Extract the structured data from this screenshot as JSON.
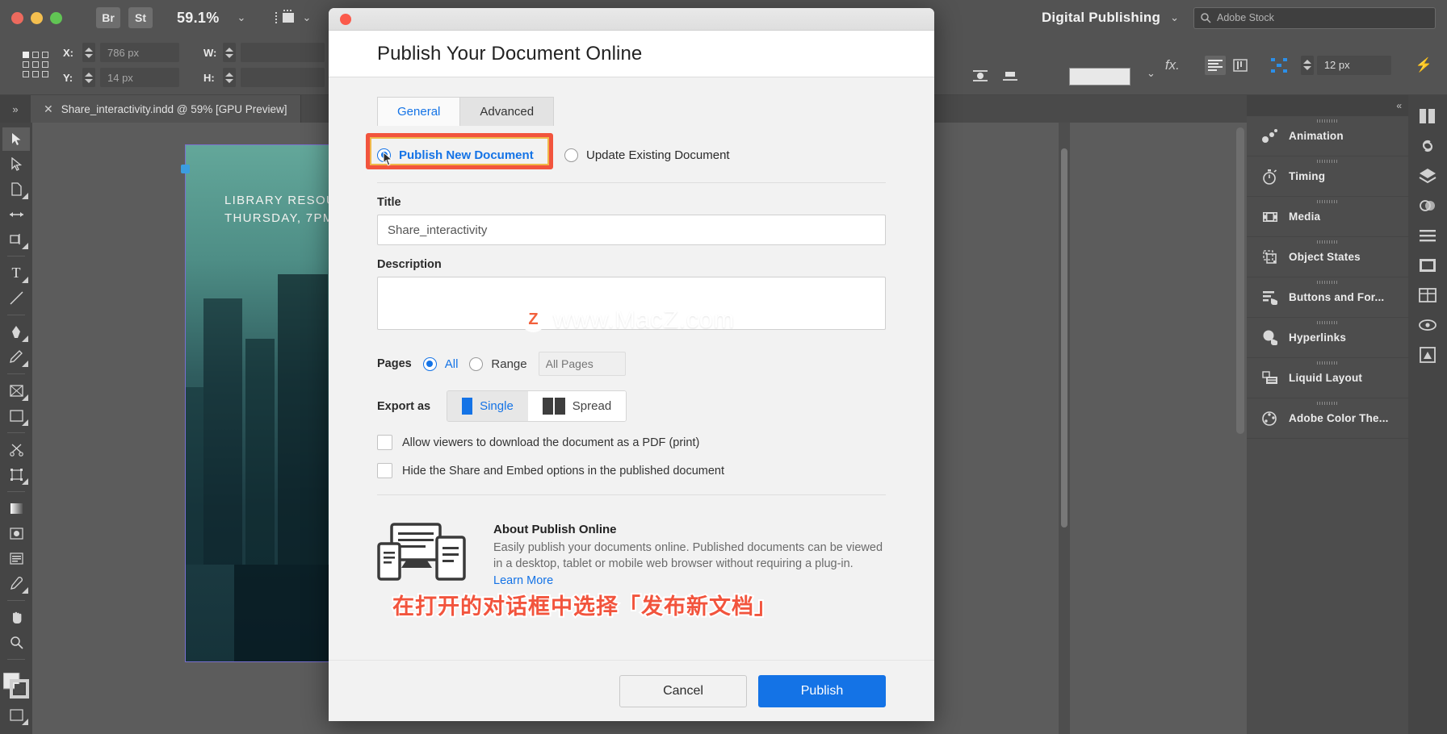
{
  "app": {
    "zoom_level": "59.1%",
    "bridge_button": "Br",
    "stock_button": "St",
    "workspace": "Digital Publishing",
    "stock_search_placeholder": "Adobe Stock",
    "document_tab": "Share_interactivity.indd @ 59% [GPU Preview]"
  },
  "options_bar": {
    "x_label": "X:",
    "x_value": "786 px",
    "y_label": "Y:",
    "y_value": "14 px",
    "w_label": "W:",
    "w_value": "",
    "h_label": "H:",
    "h_value": "",
    "fx_label": "fx.",
    "leading_value": "12 px"
  },
  "page_content": {
    "line1": "LIBRARY RESOU",
    "line2": "THURSDAY, 7PM"
  },
  "panels": {
    "items": [
      {
        "label": "Animation",
        "icon": "animation-icon"
      },
      {
        "label": "Timing",
        "icon": "timing-icon"
      },
      {
        "label": "Media",
        "icon": "media-icon"
      },
      {
        "label": "Object States",
        "icon": "object-states-icon"
      },
      {
        "label": "Buttons and For...",
        "icon": "buttons-forms-icon"
      },
      {
        "label": "Hyperlinks",
        "icon": "hyperlinks-icon"
      },
      {
        "label": "Liquid Layout",
        "icon": "liquid-layout-icon"
      },
      {
        "label": "Adobe Color The...",
        "icon": "adobe-color-icon"
      }
    ],
    "collapse_glyph": "«"
  },
  "dialog": {
    "title": "Publish Your Document Online",
    "tabs": [
      {
        "label": "General",
        "active": true
      },
      {
        "label": "Advanced",
        "active": false
      }
    ],
    "mode_options": [
      {
        "label": "Publish New Document",
        "selected": true
      },
      {
        "label": "Update Existing Document",
        "selected": false
      }
    ],
    "title_field": {
      "label": "Title",
      "value": "Share_interactivity"
    },
    "description_field": {
      "label": "Description",
      "value": ""
    },
    "pages": {
      "label": "Pages",
      "all_label": "All",
      "range_label": "Range",
      "range_placeholder": "All Pages",
      "selected": "All"
    },
    "export_as": {
      "label": "Export as",
      "options": [
        {
          "label": "Single",
          "active": true
        },
        {
          "label": "Spread",
          "active": false
        }
      ]
    },
    "checkboxes": [
      {
        "label": "Allow viewers to download the document as a PDF (print)",
        "checked": false
      },
      {
        "label": "Hide the Share and Embed options in the published document",
        "checked": false
      }
    ],
    "about": {
      "heading": "About Publish Online",
      "body": "Easily publish your documents online. Published documents can be viewed in a desktop, tablet or mobile web browser without requiring a plug-in.",
      "link": "Learn More"
    },
    "footer": {
      "cancel": "Cancel",
      "publish": "Publish"
    }
  },
  "watermark": {
    "badge": "Z",
    "text": "www.MacZ.com"
  },
  "caption": {
    "text": "在打开的对话框中选择「发布新文档」"
  },
  "colors": {
    "accent_blue": "#1473e6",
    "highlight_red": "#f2543d",
    "highlight_gold": "#f0b84a",
    "chrome_gray": "#535353"
  }
}
